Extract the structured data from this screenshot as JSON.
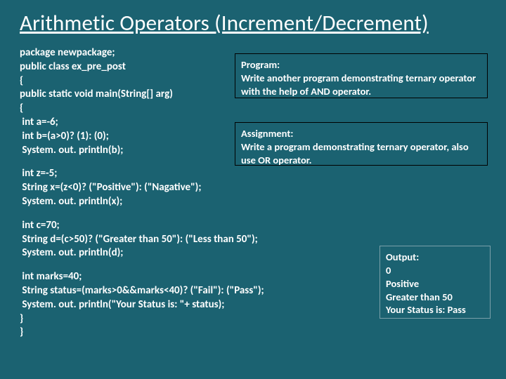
{
  "title": "Arithmetic Operators (Increment/Decrement)",
  "code": {
    "block1": "package newpackage;\npublic class ex_pre_post\n{\npublic static void main(String[] arg)\n{\n int a=-6;\n int b=(a>0)? (1): (0);\n System. out. println(b);",
    "block2": " int z=-5;\n String x=(z<0)? (\"Positive\"): (\"Nagative\");\n System. out. println(x);",
    "block3": " int c=70;\n String d=(c>50)? (\"Greater than 50\"): (\"Less than 50\");\n System. out. println(d);",
    "block4": " int marks=40;\n String status=(marks>0&&marks<40)? (\"Fail\"): (\"Pass\");\n System. out. println(\"Your Status is: \"+ status);\n}\n}"
  },
  "program_box": {
    "heading": "Program:",
    "body": "Write another program  demonstrating  ternary operator with the help of AND operator."
  },
  "assignment_box": {
    "heading": "Assignment:",
    "body": "Write a program demonstrating ternary operator, also use OR operator."
  },
  "output_box": {
    "heading": "Output:",
    "line1": "0",
    "line2": "Positive",
    "line3": "Greater than 50",
    "line4": "Your Status is: Pass"
  }
}
